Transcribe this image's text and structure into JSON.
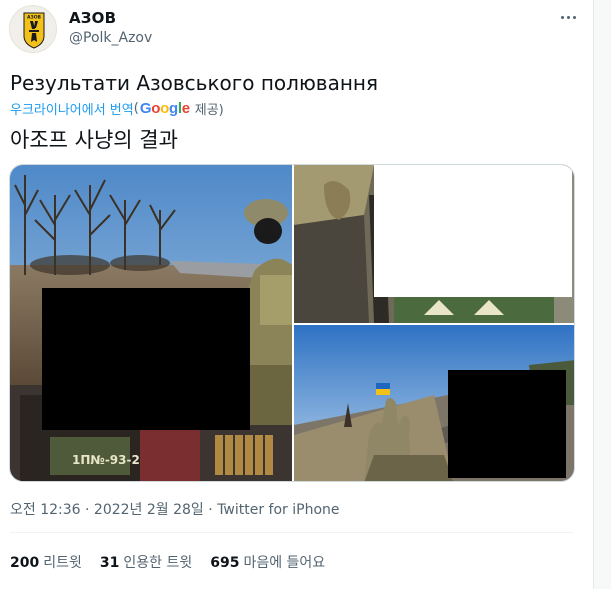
{
  "account": {
    "name": "АЗОВ",
    "handle": "@Polk_Azov",
    "avatar_logo_text": "АЗОВ"
  },
  "tweet": {
    "text": "Результати Азовського полювання",
    "translate_link": "우크라이나어에서 번역",
    "provided_by": "제공)",
    "paren_open": "(",
    "google_label": "Google",
    "translated_text": "아조프 사냥의 결과"
  },
  "media": {
    "photo1_marking": "1П№-93-2"
  },
  "meta": {
    "time": "오전 12:36",
    "date": "2022년 2월 28일",
    "source": "Twitter for iPhone",
    "separator": "·"
  },
  "stats": {
    "retweets_count": "200",
    "retweets_label": "리트윗",
    "quotes_count": "31",
    "quotes_label": "인용한 트윗",
    "likes_count": "695",
    "likes_label": "마음에 들어요"
  },
  "colors": {
    "google": [
      "#4285F4",
      "#EA4335",
      "#FBBC05",
      "#4285F4",
      "#34A853",
      "#EA4335"
    ],
    "link": "#1d9bf0",
    "secondary": "#536471",
    "redaction": "#000000",
    "logo_gold": "#f2c21b"
  },
  "icons": {
    "more": "more-dots-icon"
  }
}
